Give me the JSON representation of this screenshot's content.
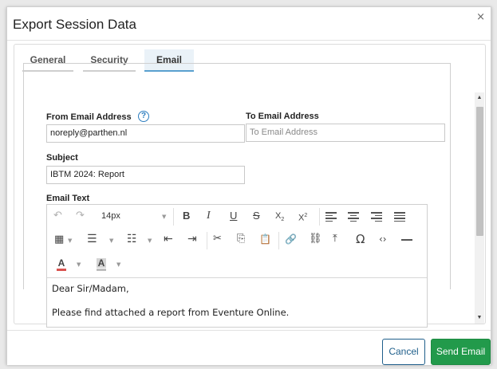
{
  "dialog": {
    "title": "Export Session Data",
    "close_glyph": "×"
  },
  "tabs": [
    {
      "label": "General",
      "active": false
    },
    {
      "label": "Security",
      "active": false
    },
    {
      "label": "Email",
      "active": true
    }
  ],
  "form": {
    "from_label": "From Email Address",
    "from_value": "noreply@parthen.nl",
    "help_glyph": "?",
    "to_label": "To Email Address",
    "to_placeholder": "To Email Address",
    "to_value": "",
    "subject_label": "Subject",
    "subject_value": "IBTM 2024: Report",
    "email_text_label": "Email Text"
  },
  "editor": {
    "font_size": "14px",
    "content": [
      "Dear Sir/Madam,",
      "Please find attached a report from Eventure Online."
    ],
    "icons": {
      "undo": "↶",
      "redo": "↷",
      "bold": "B",
      "italic": "I",
      "underline": "U",
      "strike": "S",
      "subscript": "X",
      "subscript_mark": "2",
      "superscript": "X",
      "superscript_mark": "2",
      "cut": "✂",
      "copy": "⎘",
      "paste": "📋",
      "link": "🔗",
      "unlink": "⛓",
      "upload": "⤒",
      "special_char": "Ω",
      "code": "‹›",
      "text_color": "A",
      "highlight": "A"
    },
    "text_color": "#d9534f",
    "highlight_color": "#bdbdbd"
  },
  "footer": {
    "cancel_label": "Cancel",
    "send_label": "Send Email"
  },
  "colors": {
    "send_button": "#229a4b",
    "cancel_border": "#1f5f8b",
    "tab_active_underline": "#5aa0cf",
    "help_icon": "#2b7dbf"
  }
}
